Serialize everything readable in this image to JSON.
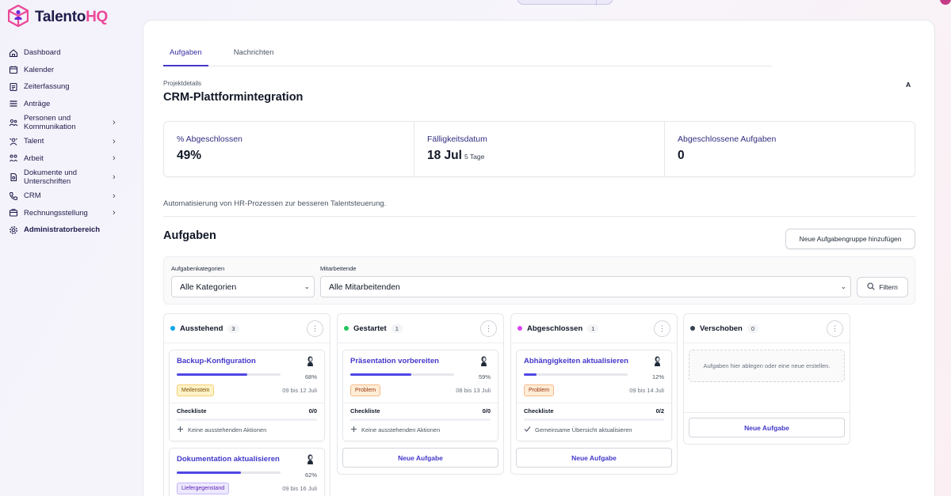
{
  "app": {
    "brand_main": "Talento",
    "brand_accent": "HQ",
    "accent_color": "#ec4899",
    "primary_color": "#4338ca"
  },
  "sidebar": {
    "items": [
      {
        "label": "Dashboard",
        "icon": "home-icon",
        "has_children": false
      },
      {
        "label": "Kalender",
        "icon": "calendar-icon",
        "has_children": false
      },
      {
        "label": "Zeiterfassung",
        "icon": "clipboard-icon",
        "has_children": false
      },
      {
        "label": "Anträge",
        "icon": "list-icon",
        "has_children": false
      },
      {
        "label": "Personen und Kommunikation",
        "icon": "people-icon",
        "has_children": true
      },
      {
        "label": "Talent",
        "icon": "talent-icon",
        "has_children": true
      },
      {
        "label": "Arbeit",
        "icon": "work-icon",
        "has_children": true
      },
      {
        "label": "Dokumente und Unterschriften",
        "icon": "document-icon",
        "has_children": true
      },
      {
        "label": "CRM",
        "icon": "phone-icon",
        "has_children": true
      },
      {
        "label": "Rechnungsstellung",
        "icon": "invoice-icon",
        "has_children": true
      },
      {
        "label": "Administratorbereich",
        "icon": "gear-icon",
        "has_children": false
      }
    ]
  },
  "tabs": [
    {
      "label": "Aufgaben",
      "active": true
    },
    {
      "label": "Nachrichten",
      "active": false
    }
  ],
  "project": {
    "label": "Projektdetails",
    "title": "CRM-Plattformintegration",
    "avatar": "A"
  },
  "stats": {
    "completed_label": "% Abgeschlossen",
    "completed_value": "49%",
    "due_label": "Fälligkeitsdatum",
    "due_value": "18 Jul",
    "due_sub": "5 Tage",
    "done_tasks_label": "Abgeschlossene Aufgaben",
    "done_tasks_value": "0"
  },
  "description": "Automatisierung von HR-Prozessen zur besseren Talentsteuerung.",
  "tasks": {
    "title": "Aufgaben",
    "add_group_button": "Neue Aufgabengruppe hinzufügen",
    "filters": {
      "category_label": "Aufgabenkategorien",
      "category_value": "Alle Kategorien",
      "employee_label": "Mitarbeitende",
      "employee_value": "Alle Mitarbeitenden",
      "filter_button": "Filtern"
    }
  },
  "columns": [
    {
      "title": "Ausstehend",
      "count": "3",
      "color": "#0ea5e9",
      "cards": [
        {
          "title": "Backup-Konfiguration",
          "progress": 68,
          "progress_text": "68%",
          "tag": "Meilenstein",
          "tag_type": "ms",
          "dates": "09 bis 12 Juli",
          "checklist_label": "Checkliste",
          "checklist_count": "0/0",
          "checklist_item": "Keine ausstehenden Aktionen",
          "checklist_icon": "plus-icon"
        },
        {
          "title": "Dokumentation aktualisieren",
          "progress": 62,
          "progress_text": "62%",
          "tag": "Liefergegenstand",
          "tag_type": "lg",
          "dates": "09 bis 16 Juli"
        }
      ],
      "new_task": null
    },
    {
      "title": "Gestartet",
      "count": "1",
      "color": "#22c55e",
      "cards": [
        {
          "title": "Präsentation vorbereiten",
          "progress": 59,
          "progress_text": "59%",
          "tag": "Problem",
          "tag_type": "pr",
          "dates": "08 bis 13 Juli",
          "checklist_label": "Checkliste",
          "checklist_count": "0/0",
          "checklist_item": "Keine ausstehenden Aktionen",
          "checklist_icon": "plus-icon"
        }
      ],
      "new_task": "Neue Aufgabe"
    },
    {
      "title": "Abgeschlossen",
      "count": "1",
      "color": "#d946ef",
      "cards": [
        {
          "title": "Abhängigkeiten aktualisieren",
          "progress": 12,
          "progress_text": "12%",
          "tag": "Problem",
          "tag_type": "pr",
          "dates": "09 bis 14 Juli",
          "checklist_label": "Checkliste",
          "checklist_count": "0/2",
          "checklist_item": "Gemeinsame Übersicht aktualisieren",
          "checklist_icon": "check-icon"
        }
      ],
      "new_task": "Neue Aufgabe"
    },
    {
      "title": "Verschoben",
      "count": "0",
      "color": "#374151",
      "empty_text": "Aufgaben hier ablegen oder eine neue erstellen.",
      "cards": [],
      "new_task": "Neue Aufgabe"
    }
  ]
}
